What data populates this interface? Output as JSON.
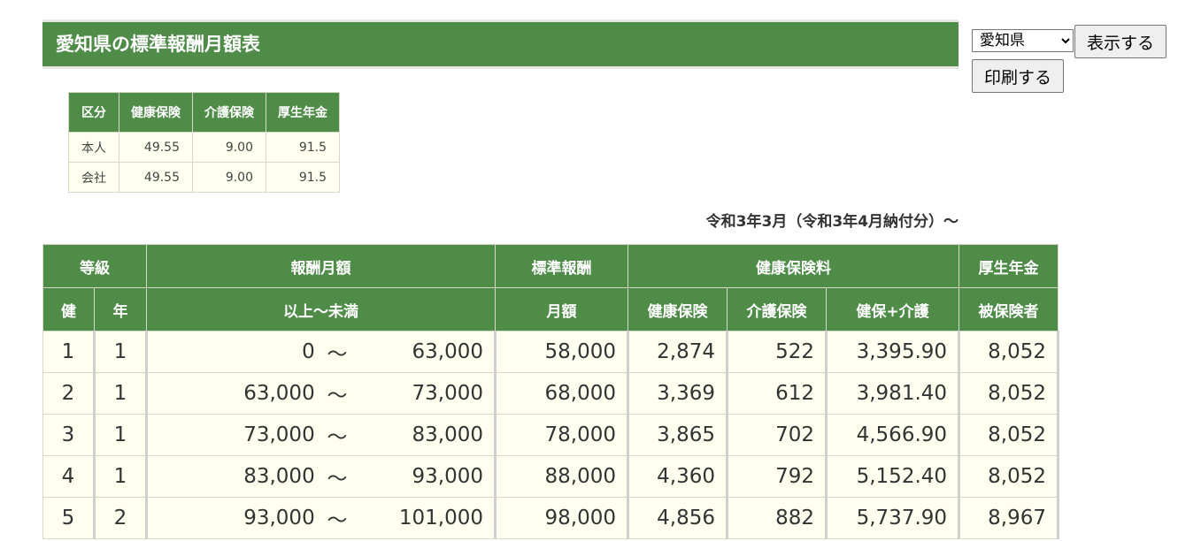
{
  "header": {
    "title": "愛知県の標準報酬月額表"
  },
  "controls": {
    "prefecture": "愛知県",
    "show_label": "表示する",
    "print_label": "印刷する"
  },
  "rate_table": {
    "headers": [
      "区分",
      "健康保険",
      "介護保険",
      "厚生年金"
    ],
    "rows": [
      [
        "本人",
        "49.55",
        "9.00",
        "91.5"
      ],
      [
        "会社",
        "49.55",
        "9.00",
        "91.5"
      ]
    ]
  },
  "period": "令和3年3月（令和3年4月納付分）～",
  "main_table": {
    "header1": {
      "grade": "等級",
      "remuneration": "報酬月額",
      "standard": "標準報酬",
      "health_premium": "健康保険料",
      "pension": "厚生年金"
    },
    "header2": {
      "ken": "健",
      "nen": "年",
      "range": "以上～未満",
      "monthly": "月額",
      "health": "健康保険",
      "care": "介護保険",
      "health_care": "健保+介護",
      "insured": "被保険者"
    },
    "tilde": "～",
    "rows": [
      {
        "ken": "1",
        "nen": "1",
        "from": "0",
        "to": "63,000",
        "standard": "58,000",
        "health": "2,874",
        "care": "522",
        "total": "3,395.90",
        "pension": "8,052"
      },
      {
        "ken": "2",
        "nen": "1",
        "from": "63,000",
        "to": "73,000",
        "standard": "68,000",
        "health": "3,369",
        "care": "612",
        "total": "3,981.40",
        "pension": "8,052"
      },
      {
        "ken": "3",
        "nen": "1",
        "from": "73,000",
        "to": "83,000",
        "standard": "78,000",
        "health": "3,865",
        "care": "702",
        "total": "4,566.90",
        "pension": "8,052"
      },
      {
        "ken": "4",
        "nen": "1",
        "from": "83,000",
        "to": "93,000",
        "standard": "88,000",
        "health": "4,360",
        "care": "792",
        "total": "5,152.40",
        "pension": "8,052"
      },
      {
        "ken": "5",
        "nen": "2",
        "from": "93,000",
        "to": "101,000",
        "standard": "98,000",
        "health": "4,856",
        "care": "882",
        "total": "5,737.90",
        "pension": "8,967"
      }
    ]
  }
}
